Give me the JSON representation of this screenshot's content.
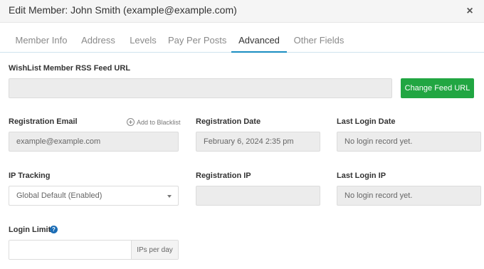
{
  "header": {
    "title": "Edit Member: John Smith (example@example.com)",
    "close_symbol": "×"
  },
  "tabs": [
    {
      "label": "Member Info",
      "active": false
    },
    {
      "label": "Address",
      "active": false
    },
    {
      "label": "Levels",
      "active": false
    },
    {
      "label": "Pay Per Posts",
      "active": false
    },
    {
      "label": "Advanced",
      "active": true
    },
    {
      "label": "Other Fields",
      "active": false
    }
  ],
  "rss": {
    "label": "WishList Member RSS Feed URL",
    "value": "",
    "button": "Change Feed URL"
  },
  "registration_email": {
    "label": "Registration Email",
    "action": "Add to Blacklist",
    "value": "example@example.com"
  },
  "registration_date": {
    "label": "Registration Date",
    "value": "February 6, 2024 2:35 pm"
  },
  "last_login_date": {
    "label": "Last Login Date",
    "value": "No login record yet."
  },
  "ip_tracking": {
    "label": "IP Tracking",
    "selected": "Global Default (Enabled)"
  },
  "registration_ip": {
    "label": "Registration IP",
    "value": ""
  },
  "last_login_ip": {
    "label": "Last Login IP",
    "value": "No login record yet."
  },
  "login_limit": {
    "label": "Login Limit",
    "help_symbol": "?",
    "value": "",
    "addon": "IPs per day"
  },
  "colors": {
    "accent": "#1a8ec1",
    "button_green": "#21a642",
    "help_blue": "#1a6cb5"
  },
  "icons": {
    "close": "close-icon",
    "add": "plus-circle-icon",
    "help": "question-circle-icon",
    "dropdown": "chevron-down-icon"
  }
}
